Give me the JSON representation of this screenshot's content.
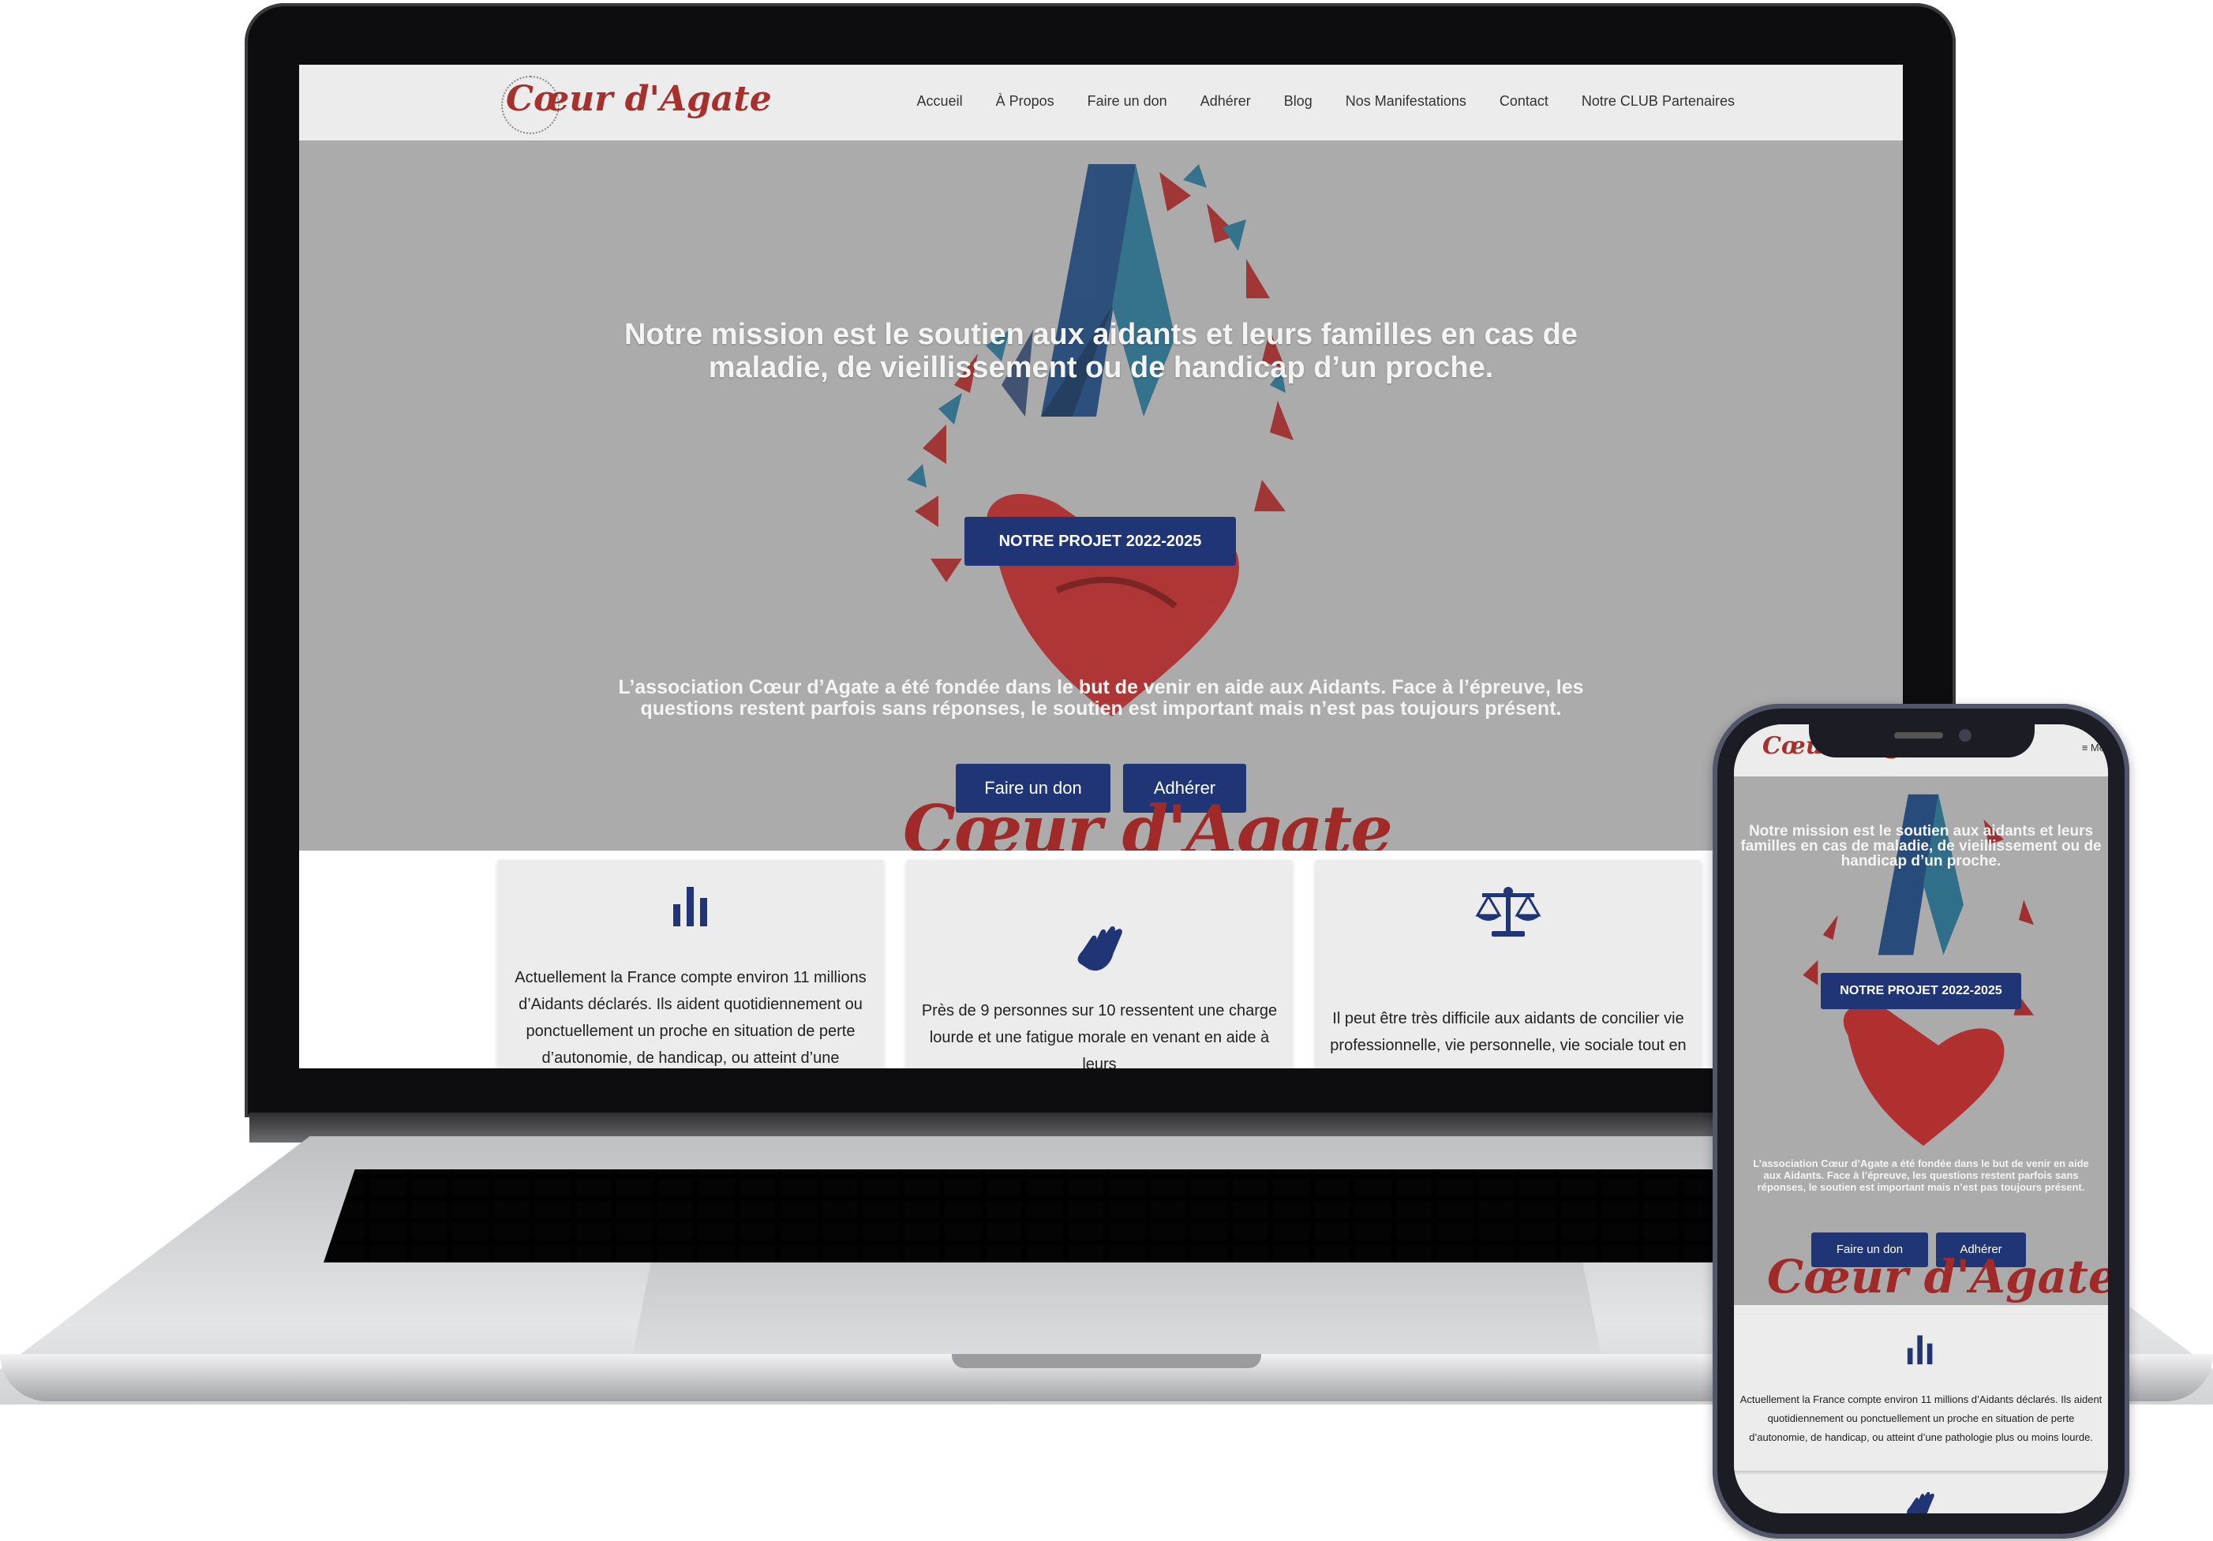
{
  "site": {
    "logo_text": "Cœur d'Agate",
    "nav": [
      "Accueil",
      "À Propos",
      "Faire un don",
      "Adhérer",
      "Blog",
      "Nos Manifestations",
      "Contact",
      "Notre CLUB Partenaires"
    ],
    "hero": {
      "title": "Notre mission est le soutien aux aidants et leurs familles en cas de maladie, de vieillissement ou de handicap d’un proche.",
      "project_button": "NOTRE PROJET 2022-2025",
      "intro": "L’association Cœur d’Agate a été fondée dans le but de venir en aide aux Aidants. Face à l’épreuve, les questions restent parfois sans réponses, le soutien est important mais n’est pas toujours présent.",
      "donate_button": "Faire un don",
      "join_button": "Adhérer",
      "logo_text": "Cœur d'Agate"
    },
    "cards": [
      {
        "icon": "bar-chart-icon",
        "text": "Actuellement la France compte environ 11 millions d’Aidants déclarés. Ils aident quotidiennement ou ponctuellement un proche en situation de perte d’autonomie, de handicap, ou atteint d’une pathologie"
      },
      {
        "icon": "hand-icon",
        "text": "Près de 9 personnes sur 10 ressentent une charge lourde et une fatigue morale en venant en aide à leurs"
      },
      {
        "icon": "balance-scale-icon",
        "text": "Il peut être très difficile aux aidants de concilier vie professionnelle, vie personnelle, vie sociale tout en"
      }
    ]
  },
  "mobile": {
    "menu_label": "≡ Me",
    "hero_title": "Notre mission est le soutien aux aidants et leurs familles en cas de maladie, de vieillissement ou de handicap d’un proche.",
    "card_text": "Actuellement la France compte environ 11 millions d’Aidants déclarés. Ils aident quotidiennement ou ponctuellement un proche en situation de perte d’autonomie, de handicap, ou atteint d’une pathologie plus ou moins lourde."
  },
  "colors": {
    "brand_red": "#a8302c",
    "button_blue": "#1f3576",
    "icon_blue": "#1f3576",
    "hero_gray": "#ababab"
  }
}
